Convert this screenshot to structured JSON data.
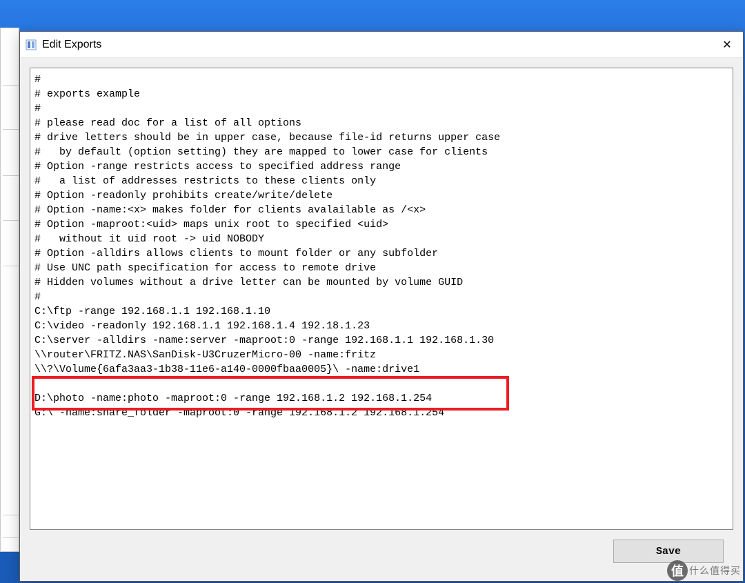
{
  "window": {
    "title": "Edit Exports",
    "close_symbol": "✕"
  },
  "exports_text": "#\n# exports example\n#\n# please read doc for a list of all options\n# drive letters should be in upper case, because file-id returns upper case\n#   by default (option setting) they are mapped to lower case for clients\n# Option -range restricts access to specified address range\n#   a list of addresses restricts to these clients only\n# Option -readonly prohibits create/write/delete\n# Option -name:<x> makes folder for clients avalailable as /<x>\n# Option -maproot:<uid> maps unix root to specified <uid>\n#   without it uid root -> uid NOBODY\n# Option -alldirs allows clients to mount folder or any subfolder\n# Use UNC path specification for access to remote drive\n# Hidden volumes without a drive letter can be mounted by volume GUID\n#\nC:\\ftp -range 192.168.1.1 192.168.1.10\nC:\\video -readonly 192.168.1.1 192.168.1.4 192.18.1.23\nC:\\server -alldirs -name:server -maproot:0 -range 192.168.1.1 192.168.1.30\n\\\\router\\FRITZ.NAS\\SanDisk-U3CruzerMicro-00 -name:fritz\n\\\\?\\Volume{6afa3aa3-1b38-11e6-a140-0000fbaa0005}\\ -name:drive1\n\nD:\\photo -name:photo -maproot:0 -range 192.168.1.2 192.168.1.254\nG:\\ -name:share_folder -maproot:0 -range 192.168.1.2 192.168.1.254",
  "buttons": {
    "save_label": "Save"
  },
  "watermark": {
    "coin_char": "值",
    "text": "什么值得买"
  },
  "highlight": {
    "purpose": "user-added export lines (D:\\photo and G:\\)"
  }
}
